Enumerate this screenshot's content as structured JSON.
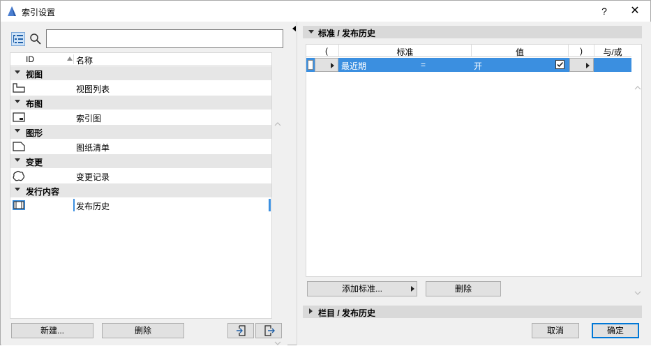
{
  "window": {
    "title": "索引设置",
    "help_label": "?",
    "close_label": "✕"
  },
  "left": {
    "search": {
      "value": "",
      "placeholder": ""
    },
    "columns": {
      "id": "ID",
      "name": "名称"
    },
    "groups": [
      {
        "label": "视图",
        "items": [
          {
            "icon": "view-list-icon",
            "name": "视图列表"
          }
        ]
      },
      {
        "label": "布图",
        "items": [
          {
            "icon": "index-layout-icon",
            "name": "索引图"
          }
        ]
      },
      {
        "label": "图形",
        "items": [
          {
            "icon": "drawing-sheet-icon",
            "name": "图纸清单"
          }
        ]
      },
      {
        "label": "变更",
        "items": [
          {
            "icon": "revision-cloud-icon",
            "name": "变更记录"
          }
        ]
      },
      {
        "label": "发行内容",
        "items": [
          {
            "icon": "publish-history-icon",
            "name": "发布历史",
            "selected": true
          }
        ]
      }
    ],
    "buttons": {
      "new": "新建...",
      "delete": "删除"
    }
  },
  "right": {
    "criteria_section": {
      "title": "标准 /  发布历史"
    },
    "columns": {
      "lparen": "(",
      "criterion": "标准",
      "value": "值",
      "rparen": ")",
      "andor": "与/或"
    },
    "rows": [
      {
        "criterion": "最近期",
        "operator": "=",
        "value": "开",
        "checked": true
      }
    ],
    "buttons": {
      "add_criterion": "添加标准...",
      "delete": "删除"
    },
    "columns_section": {
      "title": "栏目 /  发布历史"
    }
  },
  "footer": {
    "cancel": "取消",
    "ok": "确定"
  },
  "colors": {
    "selection": "#3b8fe0",
    "accent": "#0078d7"
  }
}
